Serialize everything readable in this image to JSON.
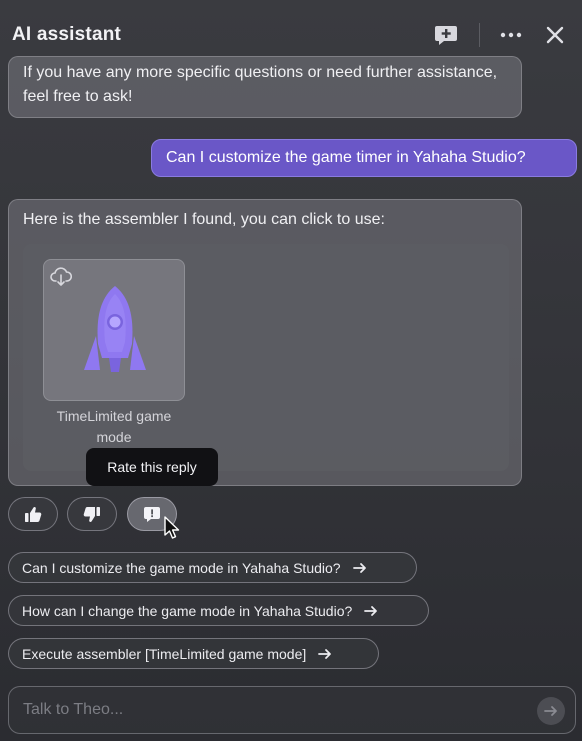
{
  "header": {
    "title": "AI assistant",
    "icons": [
      "new-chat-icon",
      "more-icon",
      "close-icon"
    ]
  },
  "messages": {
    "previous_ai_text": "If you have any more specific questions or need further assistance, feel free to ask!",
    "user_question": "Can I customize the game timer in Yahaha Studio?",
    "ai_reply_text": "Here is the assembler I found, you can click to use:",
    "assembler": {
      "name": "TimeLimited game mode",
      "icon": "rocket-icon",
      "download_icon": "cloud-download-icon"
    }
  },
  "tooltip": {
    "text": "Rate this reply"
  },
  "rating": {
    "icons": [
      "thumbs-up-icon",
      "thumbs-down-icon",
      "feedback-icon"
    ]
  },
  "suggestions": [
    {
      "label": "Can I customize the game mode in Yahaha Studio?"
    },
    {
      "label": "How can I change the game mode in Yahaha Studio?"
    },
    {
      "label": "Execute assembler [TimeLimited game mode]"
    }
  ],
  "input": {
    "placeholder": "Talk to Theo...",
    "value": ""
  },
  "colors": {
    "accent_purple": "#6a57c7",
    "rocket_purple": "#8f78f0",
    "background": "#35363b"
  }
}
